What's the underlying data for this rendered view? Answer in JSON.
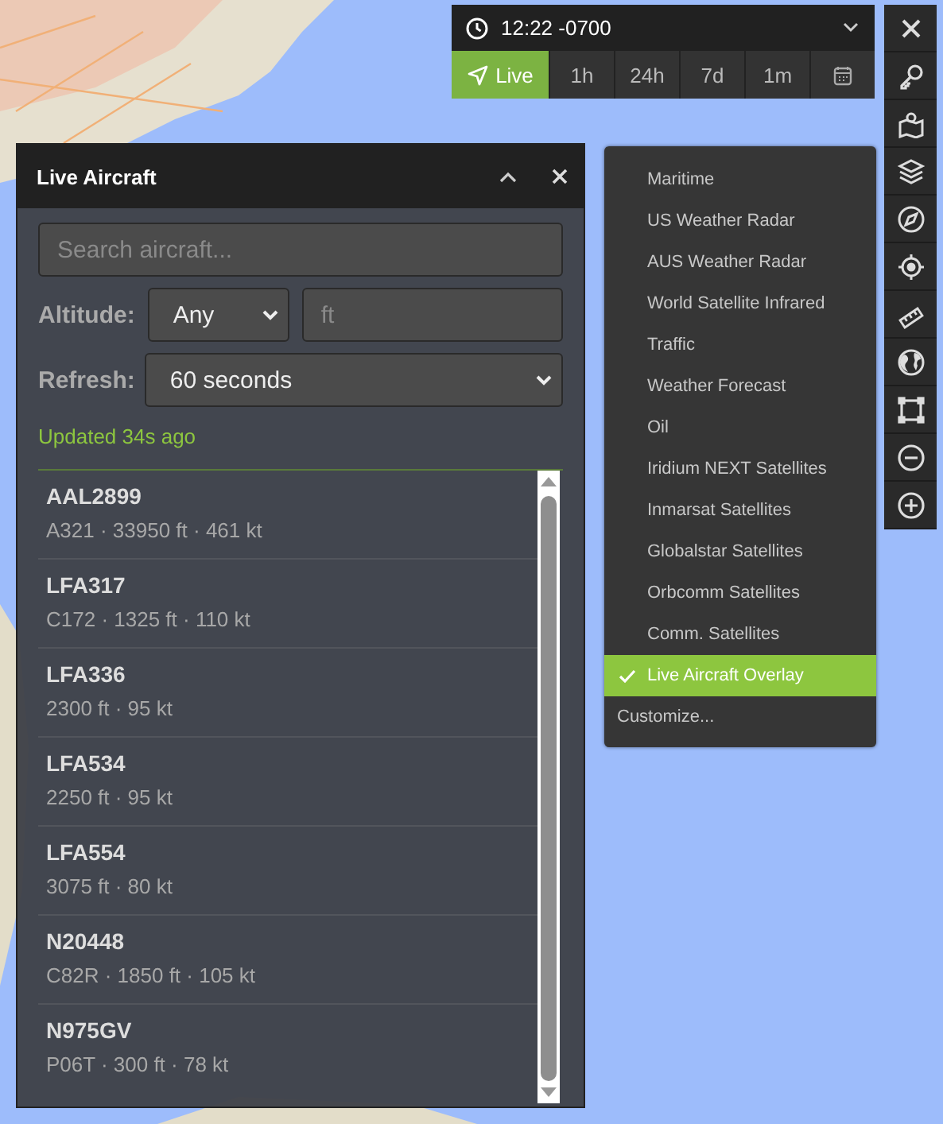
{
  "time_bar": {
    "time": "12:22 -0700",
    "ranges": [
      {
        "kind": "live",
        "label": "Live",
        "selected": true
      },
      {
        "kind": "range",
        "label": "1h",
        "selected": false
      },
      {
        "kind": "range",
        "label": "24h",
        "selected": false
      },
      {
        "kind": "range",
        "label": "7d",
        "selected": false
      },
      {
        "kind": "range",
        "label": "1m",
        "selected": false
      },
      {
        "kind": "calendar",
        "selected": false
      }
    ]
  },
  "layers_menu": {
    "items": [
      {
        "label": "Maritime",
        "checked": false
      },
      {
        "label": "US Weather Radar",
        "checked": false
      },
      {
        "label": "AUS Weather Radar",
        "checked": false
      },
      {
        "label": "World Satellite Infrared",
        "checked": false
      },
      {
        "label": "Traffic",
        "checked": false
      },
      {
        "label": "Weather Forecast",
        "checked": false
      },
      {
        "label": "Oil",
        "checked": false
      },
      {
        "label": "Iridium NEXT Satellites",
        "checked": false
      },
      {
        "label": "Inmarsat Satellites",
        "checked": false
      },
      {
        "label": "Globalstar Satellites",
        "checked": false
      },
      {
        "label": "Orbcomm Satellites",
        "checked": false
      },
      {
        "label": "Comm. Satellites",
        "checked": false
      },
      {
        "label": "Live Aircraft Overlay",
        "checked": true
      }
    ],
    "customize": "Customize..."
  },
  "panel": {
    "title": "Live Aircraft",
    "search": {
      "placeholder": "Search aircraft..."
    },
    "altitude": {
      "label": "Altitude:",
      "value": "Any",
      "placeholder": "ft"
    },
    "refresh": {
      "label": "Refresh:",
      "value": "60 seconds"
    },
    "status": "Updated 34s ago",
    "aircraft": [
      {
        "callsign": "AAL2899",
        "details": "A321 · 33950 ft · 461 kt"
      },
      {
        "callsign": "LFA317",
        "details": "C172 · 1325 ft · 110 kt"
      },
      {
        "callsign": "LFA336",
        "details": "2300 ft · 95 kt"
      },
      {
        "callsign": "LFA534",
        "details": "2250 ft · 95 kt"
      },
      {
        "callsign": "LFA554",
        "details": "3075 ft · 80 kt"
      },
      {
        "callsign": "N20448",
        "details": "C82R · 1850 ft · 105 kt"
      },
      {
        "callsign": "N975GV",
        "details": "P06T · 300 ft · 78 kt"
      }
    ]
  }
}
